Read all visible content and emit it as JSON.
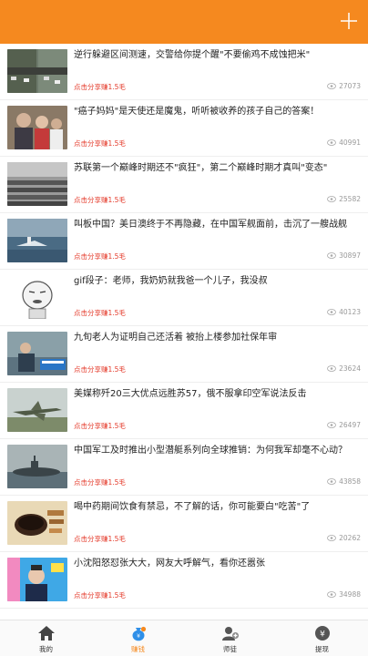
{
  "header": {
    "add_icon": "plus-icon",
    "bg_color": "#f5891f"
  },
  "articles": [
    {
      "title": "逆行躲避区间测速，交警给你提个醒\"不要偷鸡不成蚀把米\"",
      "share": "点击分享赚1.5毛",
      "views": "27073",
      "thumb": "highway-road-thumbnail"
    },
    {
      "title": "\"癌子妈妈\"是天使还是魔鬼，听听被收养的孩子自己的答案！",
      "share": "点击分享赚1.5毛",
      "views": "40991",
      "thumb": "family-photo-thumbnail"
    },
    {
      "title": "苏联第一个巅峰时期还不\"疯狂\"，第二个巅峰时期才真叫\"变态\"",
      "share": "点击分享赚1.5毛",
      "views": "25582",
      "thumb": "military-photo-thumbnail"
    },
    {
      "title": "叫板中国？美日澳终于不再隐藏，在中国军舰面前，击沉了一艘战舰",
      "share": "点击分享赚1.5毛",
      "views": "30897",
      "thumb": "warship-thumbnail"
    },
    {
      "title": "gif段子：老师，我奶奶就我爸一个儿子，我没叔",
      "share": "点击分享赚1.5毛",
      "views": "40123",
      "thumb": "cartoon-face-thumbnail"
    },
    {
      "title": "九旬老人为证明自己还活着 被抬上楼参加社保年审",
      "share": "点击分享赚1.5毛",
      "views": "23624",
      "thumb": "news-photo-thumbnail"
    },
    {
      "title": "美媒称歼20三大优点远胜苏57，俄不服拿印空军说法反击",
      "share": "点击分享赚1.5毛",
      "views": "26497",
      "thumb": "fighter-jet-thumbnail"
    },
    {
      "title": "中国军工及时推出小型潜艇系列向全球推销：为何我军却毫不心动？",
      "share": "点击分享赚1.5毛",
      "views": "43858",
      "thumb": "submarine-thumbnail"
    },
    {
      "title": "喝中药期间饮食有禁忌，不了解的话，你可能要白\"吃苦\"了",
      "share": "点击分享赚1.5毛",
      "views": "20262",
      "thumb": "herbal-medicine-thumbnail"
    },
    {
      "title": "小沈阳怒怼张大大，网友大呼解气，看你还嚣张",
      "share": "点击分享赚1.5毛",
      "views": "34988",
      "thumb": "tv-show-thumbnail"
    }
  ],
  "nav": [
    {
      "label": "我的",
      "icon": "home-icon",
      "active": false
    },
    {
      "label": "赚钱",
      "icon": "money-bag-icon",
      "active": true
    },
    {
      "label": "师徒",
      "icon": "person-add-icon",
      "active": false
    },
    {
      "label": "提现",
      "icon": "withdraw-icon",
      "active": false
    }
  ],
  "colors": {
    "accent": "#f5891f",
    "share_red": "#e43a2a",
    "muted": "#999999"
  }
}
